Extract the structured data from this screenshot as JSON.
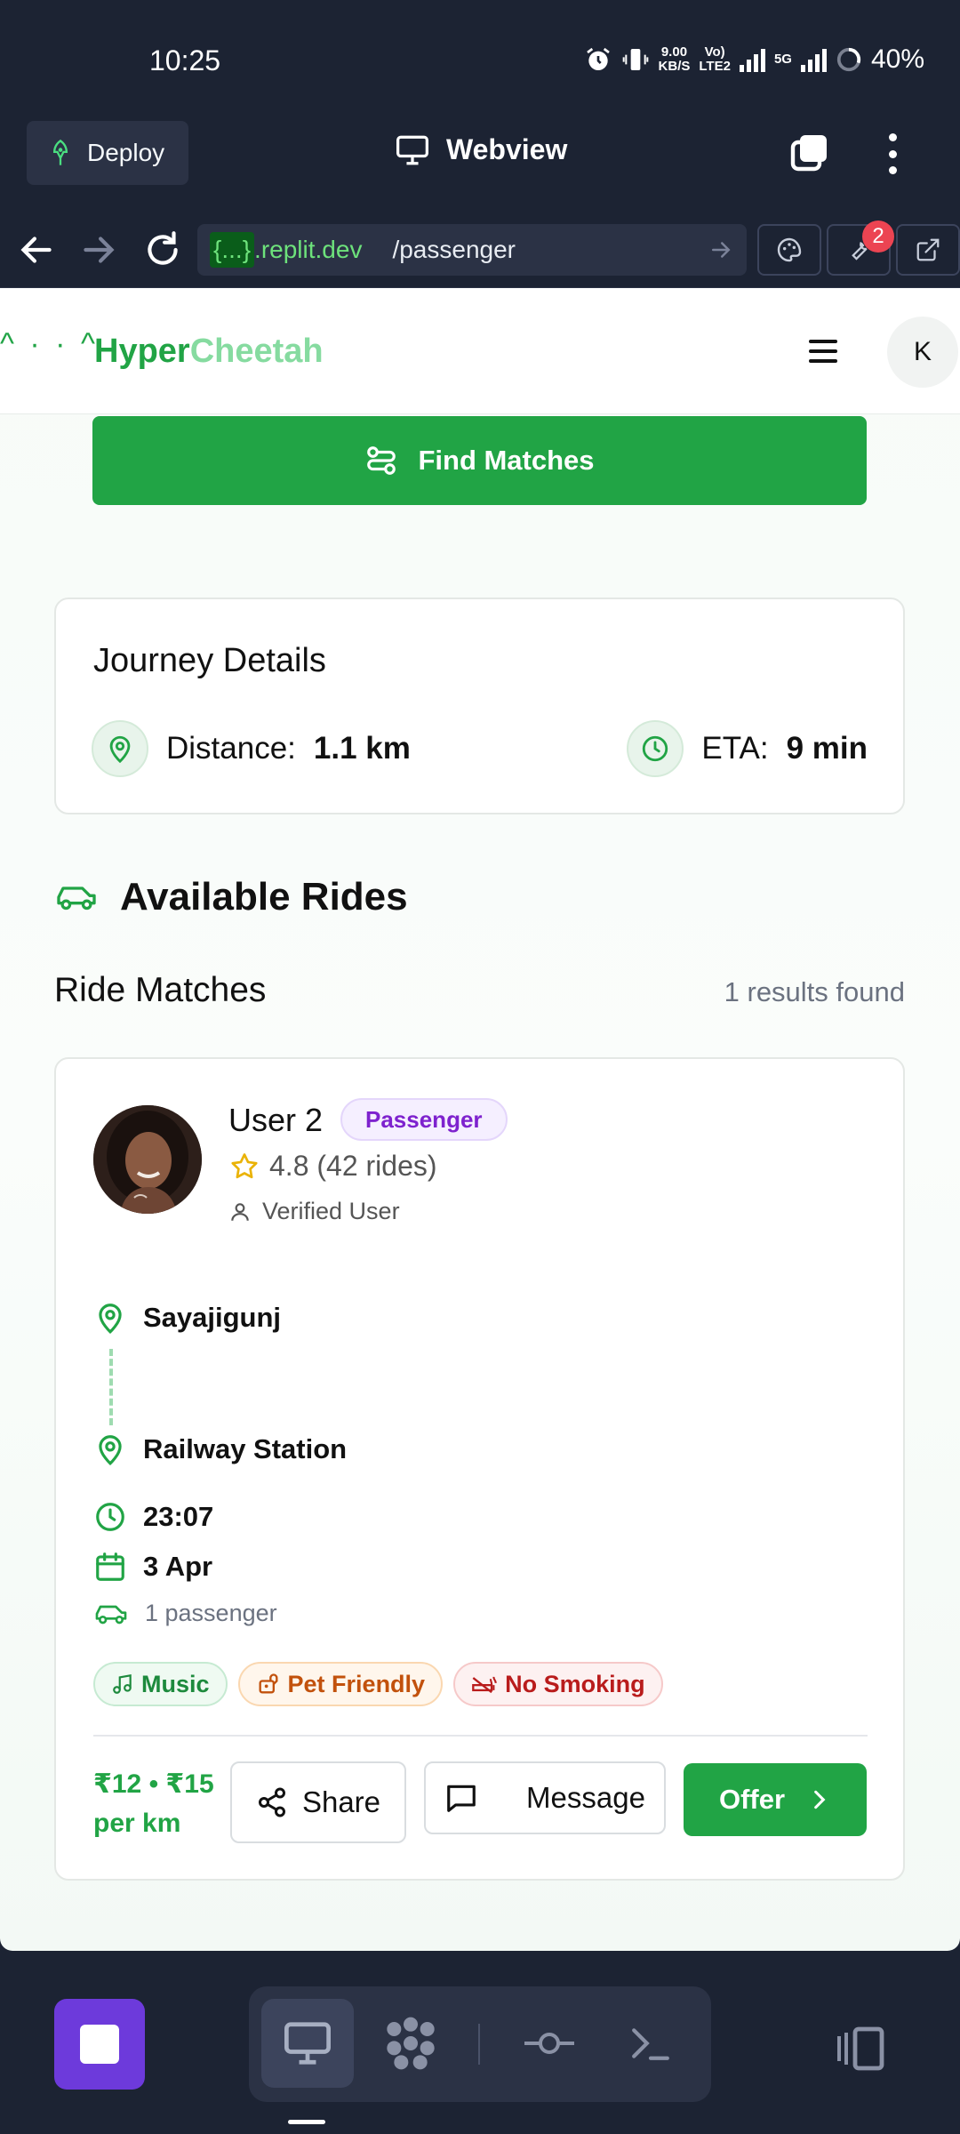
{
  "status_bar": {
    "time": "10:25",
    "net_speed_top": "9.00",
    "net_speed_bottom": "KB/S",
    "volte_top": "Vo)",
    "volte_bottom": "LTE2",
    "network": "5G",
    "battery": "40%"
  },
  "replit_bar": {
    "deploy_label": "Deploy",
    "webview_label": "Webview"
  },
  "url_bar": {
    "host_brace": "{...}",
    "host": ".replit.dev",
    "path": "/passenger",
    "badge_count": "2"
  },
  "app_header": {
    "faces": "^ · · ^",
    "brand_part1": "Hyper",
    "brand_part2": "Cheetah",
    "avatar_initial": "K"
  },
  "find_matches": {
    "label": "Find Matches"
  },
  "journey": {
    "title": "Journey Details",
    "distance_label": "Distance:",
    "distance_value": "1.1 km",
    "eta_label": "ETA:",
    "eta_value": "9 min"
  },
  "available_rides": {
    "title": "Available Rides"
  },
  "ride_matches": {
    "title": "Ride Matches",
    "count": "1 results found"
  },
  "ride": {
    "name": "User 2",
    "role": "Passenger",
    "rating": "4.8 (42 rides)",
    "verified": "Verified User",
    "from": "Sayajigunj",
    "to": "Railway Station",
    "time": "23:07",
    "date": "3 Apr",
    "passengers": "1 passenger",
    "tags": [
      "Music",
      "Pet Friendly",
      "No Smoking"
    ],
    "price_line1": "₹12 • ₹15",
    "price_line2": "per km",
    "share_label": "Share",
    "message_label": "Message",
    "offer_label": "Offer"
  },
  "colors": {
    "brand_green": "#21a445",
    "brand_light": "#86dba0",
    "ide_bg": "#1c2333",
    "role_purple": "#7e22ce"
  }
}
